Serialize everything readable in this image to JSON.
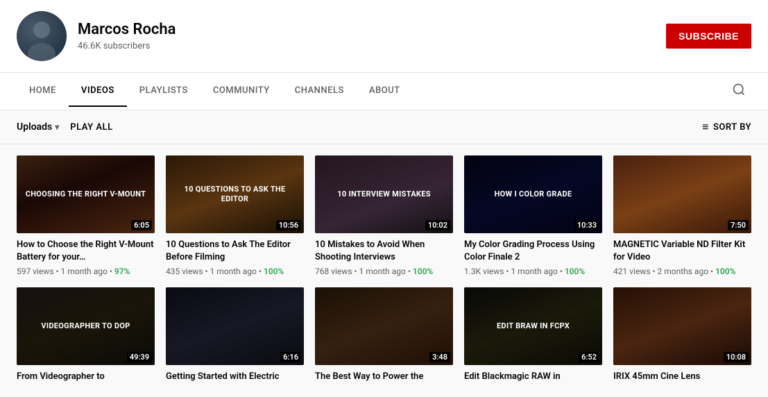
{
  "channel": {
    "name": "Marcos Rocha",
    "subscribers": "46.6K subscribers",
    "subscribe_label": "SUBSCRIBE"
  },
  "nav": {
    "tabs": [
      {
        "id": "home",
        "label": "HOME",
        "active": false
      },
      {
        "id": "videos",
        "label": "VIDEOS",
        "active": true
      },
      {
        "id": "playlists",
        "label": "PLAYLISTS",
        "active": false
      },
      {
        "id": "community",
        "label": "COMMUNITY",
        "active": false
      },
      {
        "id": "channels",
        "label": "CHANNELS",
        "active": false
      },
      {
        "id": "about",
        "label": "ABOUT",
        "active": false
      }
    ]
  },
  "toolbar": {
    "uploads_label": "Uploads",
    "play_all_label": "PLAY ALL",
    "sort_by_label": "SORT BY"
  },
  "videos": [
    {
      "id": 1,
      "title": "How to Choose the Right V-Mount Battery for your…",
      "duration": "6:05",
      "views": "597 views",
      "age": "1 month ago",
      "match": "97%",
      "thumb_text": "CHOOSING THE RIGHT V-MOUNT",
      "thumb_class": "thumb-1-bg"
    },
    {
      "id": 2,
      "title": "10 Questions to Ask The Editor Before Filming",
      "duration": "10:56",
      "views": "435 views",
      "age": "1 month ago",
      "match": "100%",
      "thumb_text": "10 QUESTIONS TO ASK THE EDITOR",
      "thumb_class": "thumb-2-bg"
    },
    {
      "id": 3,
      "title": "10 Mistakes to Avoid When Shooting Interviews",
      "duration": "10:02",
      "views": "768 views",
      "age": "1 month ago",
      "match": "100%",
      "thumb_text": "10 Interview Mistakes",
      "thumb_class": "thumb-3-bg"
    },
    {
      "id": 4,
      "title": "My Color Grading Process Using Color Finale 2",
      "duration": "10:33",
      "views": "1.3K views",
      "age": "1 month ago",
      "match": "100%",
      "thumb_text": "HOW I COLOR GRADE",
      "thumb_class": "thumb-4-bg"
    },
    {
      "id": 5,
      "title": "MAGNETIC Variable ND Filter Kit for Video",
      "duration": "7:50",
      "views": "421 views",
      "age": "2 months ago",
      "match": "100%",
      "thumb_text": "",
      "thumb_class": "thumb-5-bg"
    },
    {
      "id": 6,
      "title": "From Videographer to",
      "duration": "49:39",
      "views": "",
      "age": "",
      "match": "",
      "thumb_text": "VIDEOGRAPHER to DOP",
      "thumb_class": "thumb-6-bg"
    },
    {
      "id": 7,
      "title": "Getting Started with Electric",
      "duration": "6:16",
      "views": "",
      "age": "",
      "match": "",
      "thumb_text": "",
      "thumb_class": "thumb-7-bg"
    },
    {
      "id": 8,
      "title": "The Best Way to Power the",
      "duration": "3:48",
      "views": "",
      "age": "",
      "match": "",
      "thumb_text": "",
      "thumb_class": "thumb-8-bg"
    },
    {
      "id": 9,
      "title": "Edit Blackmagic RAW in",
      "duration": "6:52",
      "views": "",
      "age": "",
      "match": "",
      "thumb_text": "EDIT BRAW IN FCPX",
      "thumb_class": "thumb-9-bg"
    },
    {
      "id": 10,
      "title": "IRIX 45mm Cine Lens",
      "duration": "10:08",
      "views": "",
      "age": "",
      "match": "",
      "thumb_text": "",
      "thumb_class": "thumb-10-bg"
    }
  ]
}
